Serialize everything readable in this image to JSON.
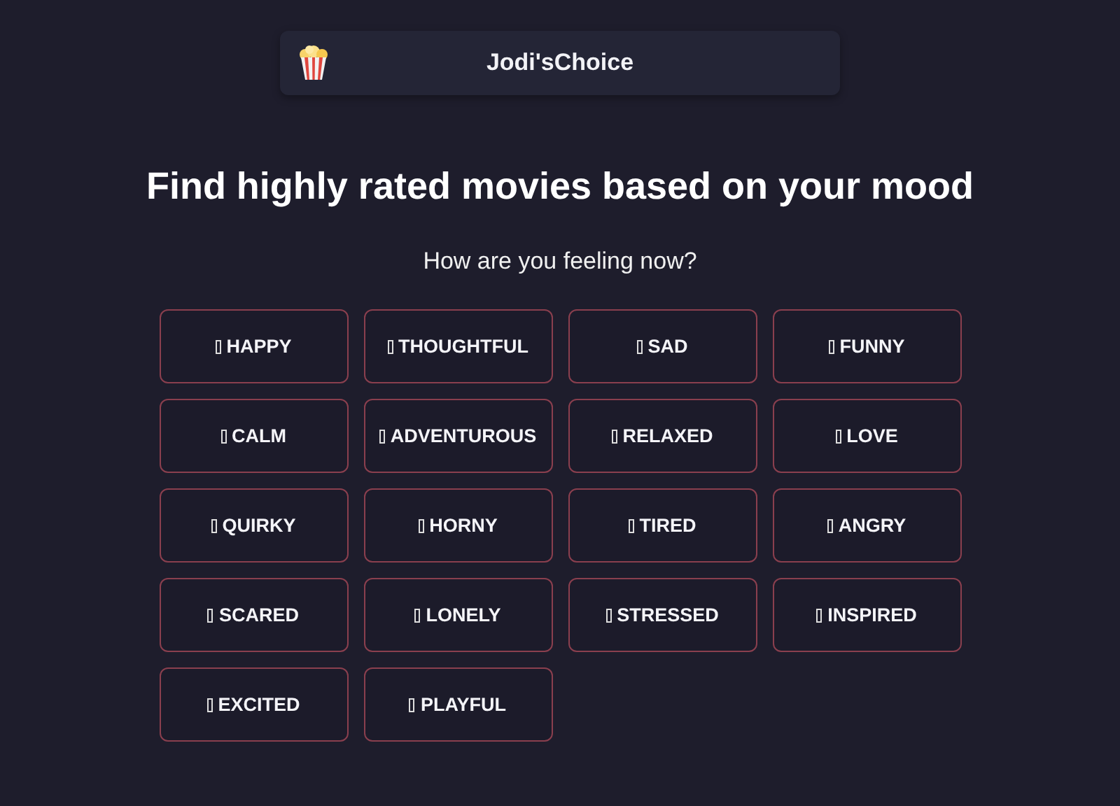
{
  "header": {
    "title": "Jodi'sChoice"
  },
  "heading": "Find highly rated movies based on your mood",
  "question": "How are you feeling now?",
  "moods": [
    {
      "label": "HAPPY"
    },
    {
      "label": "THOUGHTFUL"
    },
    {
      "label": "SAD"
    },
    {
      "label": "FUNNY"
    },
    {
      "label": "CALM"
    },
    {
      "label": "ADVENTUROUS"
    },
    {
      "label": "RELAXED"
    },
    {
      "label": "LOVE"
    },
    {
      "label": "QUIRKY"
    },
    {
      "label": "HORNY"
    },
    {
      "label": "TIRED"
    },
    {
      "label": "ANGRY"
    },
    {
      "label": "SCARED"
    },
    {
      "label": "LONELY"
    },
    {
      "label": "STRESSED"
    },
    {
      "label": "INSPIRED"
    },
    {
      "label": "EXCITED"
    },
    {
      "label": "PLAYFUL"
    }
  ]
}
